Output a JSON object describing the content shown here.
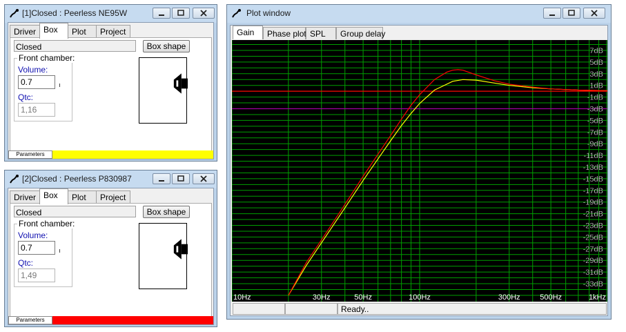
{
  "window1": {
    "title": "[1]Closed : Peerless NE95W",
    "tabs": [
      {
        "label": "Driver"
      },
      {
        "label": "Box"
      },
      {
        "label": "Plot"
      },
      {
        "label": "Project"
      }
    ],
    "active_tab": "Box",
    "box_type": "Closed",
    "box_shape_button": "Box shape",
    "front_chamber_label": "Front chamber:",
    "volume_label": "Volume:",
    "volume_value": "0.7",
    "qtc_label": "Qtc:",
    "qtc_value": "1,16",
    "parameters_label": "Parameters",
    "color": "#ffff00"
  },
  "window2": {
    "title": "[2]Closed : Peerless P830987",
    "tabs": [
      {
        "label": "Driver"
      },
      {
        "label": "Box"
      },
      {
        "label": "Plot"
      },
      {
        "label": "Project"
      }
    ],
    "active_tab": "Box",
    "box_type": "Closed",
    "box_shape_button": "Box shape",
    "front_chamber_label": "Front chamber:",
    "volume_label": "Volume:",
    "volume_value": "0.7",
    "qtc_label": "Qtc:",
    "qtc_value": "1,49",
    "parameters_label": "Parameters",
    "color": "#ff0000"
  },
  "plot_window": {
    "title": "Plot window",
    "tabs": [
      {
        "label": "Gain"
      },
      {
        "label": "Phase plot"
      },
      {
        "label": "SPL"
      },
      {
        "label": "Group delay"
      }
    ],
    "active_tab": "Gain",
    "status_text": "Ready..",
    "grid_color": "#00a000",
    "background_color": "#000000"
  },
  "chart_data": {
    "type": "line",
    "title": "",
    "xlabel": "",
    "ylabel": "",
    "x_scale": "log",
    "xlim": [
      10,
      1000
    ],
    "ylim": [
      -35,
      9
    ],
    "x_tick_labels": [
      {
        "value": 10,
        "label": "10Hz"
      },
      {
        "value": 30,
        "label": "30Hz"
      },
      {
        "value": 50,
        "label": "50Hz"
      },
      {
        "value": 100,
        "label": "100Hz"
      },
      {
        "value": 300,
        "label": "300Hz"
      },
      {
        "value": 500,
        "label": "500Hz"
      },
      {
        "value": 1000,
        "label": "1kHz"
      }
    ],
    "y_tick_labels": [
      "7dB",
      "5dB",
      "3dB",
      "1dB",
      "-1dB",
      "-3dB",
      "-5dB",
      "-7dB",
      "-9dB",
      "-11dB",
      "-13dB",
      "-15dB",
      "-17dB",
      "-19dB",
      "-21dB",
      "-23dB",
      "-25dB",
      "-27dB",
      "-29dB",
      "-31dB",
      "-33dB"
    ],
    "y_tick_values": [
      7,
      5,
      3,
      1,
      -1,
      -3,
      -5,
      -7,
      -9,
      -11,
      -13,
      -15,
      -17,
      -19,
      -21,
      -23,
      -25,
      -27,
      -29,
      -31,
      -33
    ],
    "grid": true,
    "reference_lines": [
      {
        "y": 0,
        "color": "#ff0000"
      },
      {
        "y": -3,
        "color": "#a000a0"
      }
    ],
    "series": [
      {
        "color": "#ffff00",
        "x": [
          20,
          25,
          30,
          40,
          50,
          60,
          70,
          80,
          90,
          100,
          120,
          150,
          170,
          200,
          250,
          300,
          400,
          500,
          700,
          1000
        ],
        "y": [
          -35,
          -29.8,
          -26.0,
          -20.0,
          -15.3,
          -11.6,
          -8.5,
          -5.9,
          -3.8,
          -2.1,
          0.2,
          1.7,
          2.0,
          1.9,
          1.4,
          1.0,
          0.6,
          0.4,
          0.2,
          0.1
        ]
      },
      {
        "color": "#ff0000",
        "x": [
          20,
          25,
          30,
          40,
          50,
          60,
          70,
          80,
          90,
          100,
          120,
          140,
          150,
          160,
          170,
          200,
          250,
          300,
          400,
          500,
          700,
          1000
        ],
        "y": [
          -35,
          -29.3,
          -25.5,
          -19.4,
          -14.6,
          -10.8,
          -7.6,
          -4.8,
          -2.4,
          -0.6,
          2.0,
          3.3,
          3.6,
          3.7,
          3.6,
          2.8,
          1.8,
          1.2,
          0.7,
          0.4,
          0.2,
          0.1
        ]
      }
    ]
  }
}
